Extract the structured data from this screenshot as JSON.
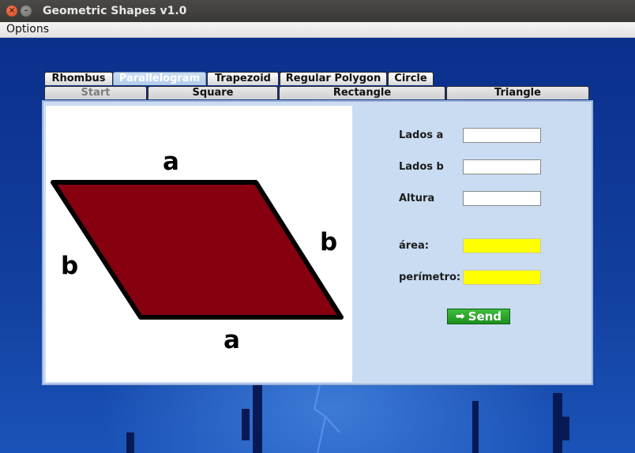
{
  "window": {
    "title": "Geometric Shapes v1.0",
    "close_glyph": "×",
    "minimize_glyph": "–"
  },
  "menu": [
    "Options"
  ],
  "tabs": {
    "row1": [
      "Rhombus",
      "Parallelogram",
      "Trapezoid",
      "Regular Polygon",
      "Circle"
    ],
    "row2": [
      "Start",
      "Square",
      "Rectangle",
      "Triangle"
    ],
    "selected": "Parallelogram"
  },
  "drawing": {
    "fill_color": "#86000f",
    "stroke_color": "#000000",
    "side_labels": {
      "top": "a",
      "bottom": "a",
      "left": "b",
      "right": "b"
    }
  },
  "form": {
    "fields": [
      {
        "label": "Lados a",
        "value": ""
      },
      {
        "label": "Lados b",
        "value": ""
      },
      {
        "label": "Altura",
        "value": ""
      }
    ],
    "results": [
      {
        "label": "área:",
        "value": ""
      },
      {
        "label": "perímetro:",
        "value": ""
      }
    ],
    "result_color": "#ffff00",
    "send_label": "Send",
    "send_icon": "arrow-right-icon",
    "send_color": "#2aa52a"
  }
}
